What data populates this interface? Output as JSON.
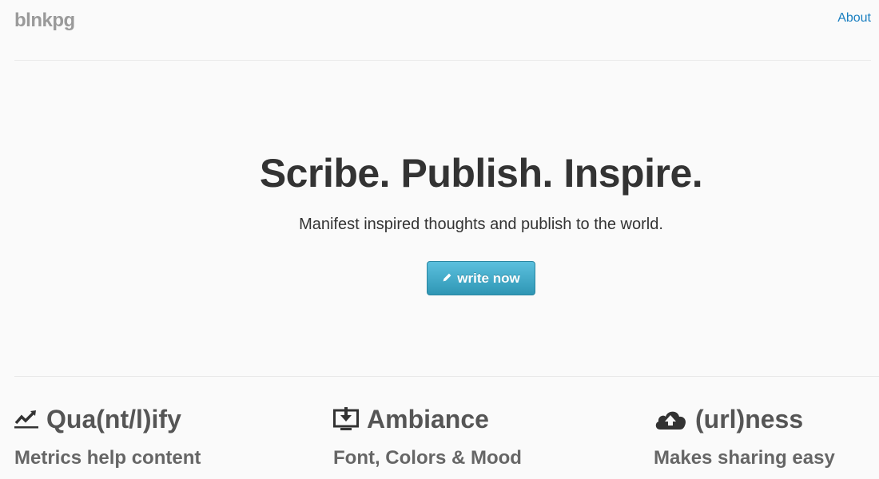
{
  "header": {
    "brand": "blnkpg",
    "about_link": "About"
  },
  "hero": {
    "title": "Scribe. Publish. Inspire.",
    "subtitle": "Manifest inspired thoughts and publish to the world.",
    "cta_label": "write now",
    "cta_icon": "pencil-icon"
  },
  "features": [
    {
      "title": "Qua(nt/l)ify",
      "subtitle": "Metrics help content",
      "icon": "trending-chart-icon"
    },
    {
      "title": "Ambiance",
      "subtitle": "Font, Colors & Mood",
      "icon": "monitor-download-icon"
    },
    {
      "title": "(url)ness",
      "subtitle": "Makes sharing easy",
      "icon": "cloud-upload-icon"
    }
  ],
  "colors": {
    "brand": "#9a9a9a",
    "link": "#1a7fc0",
    "button_top": "#5bc0de",
    "button_bottom": "#2f96b4",
    "background": "#fafafa"
  }
}
